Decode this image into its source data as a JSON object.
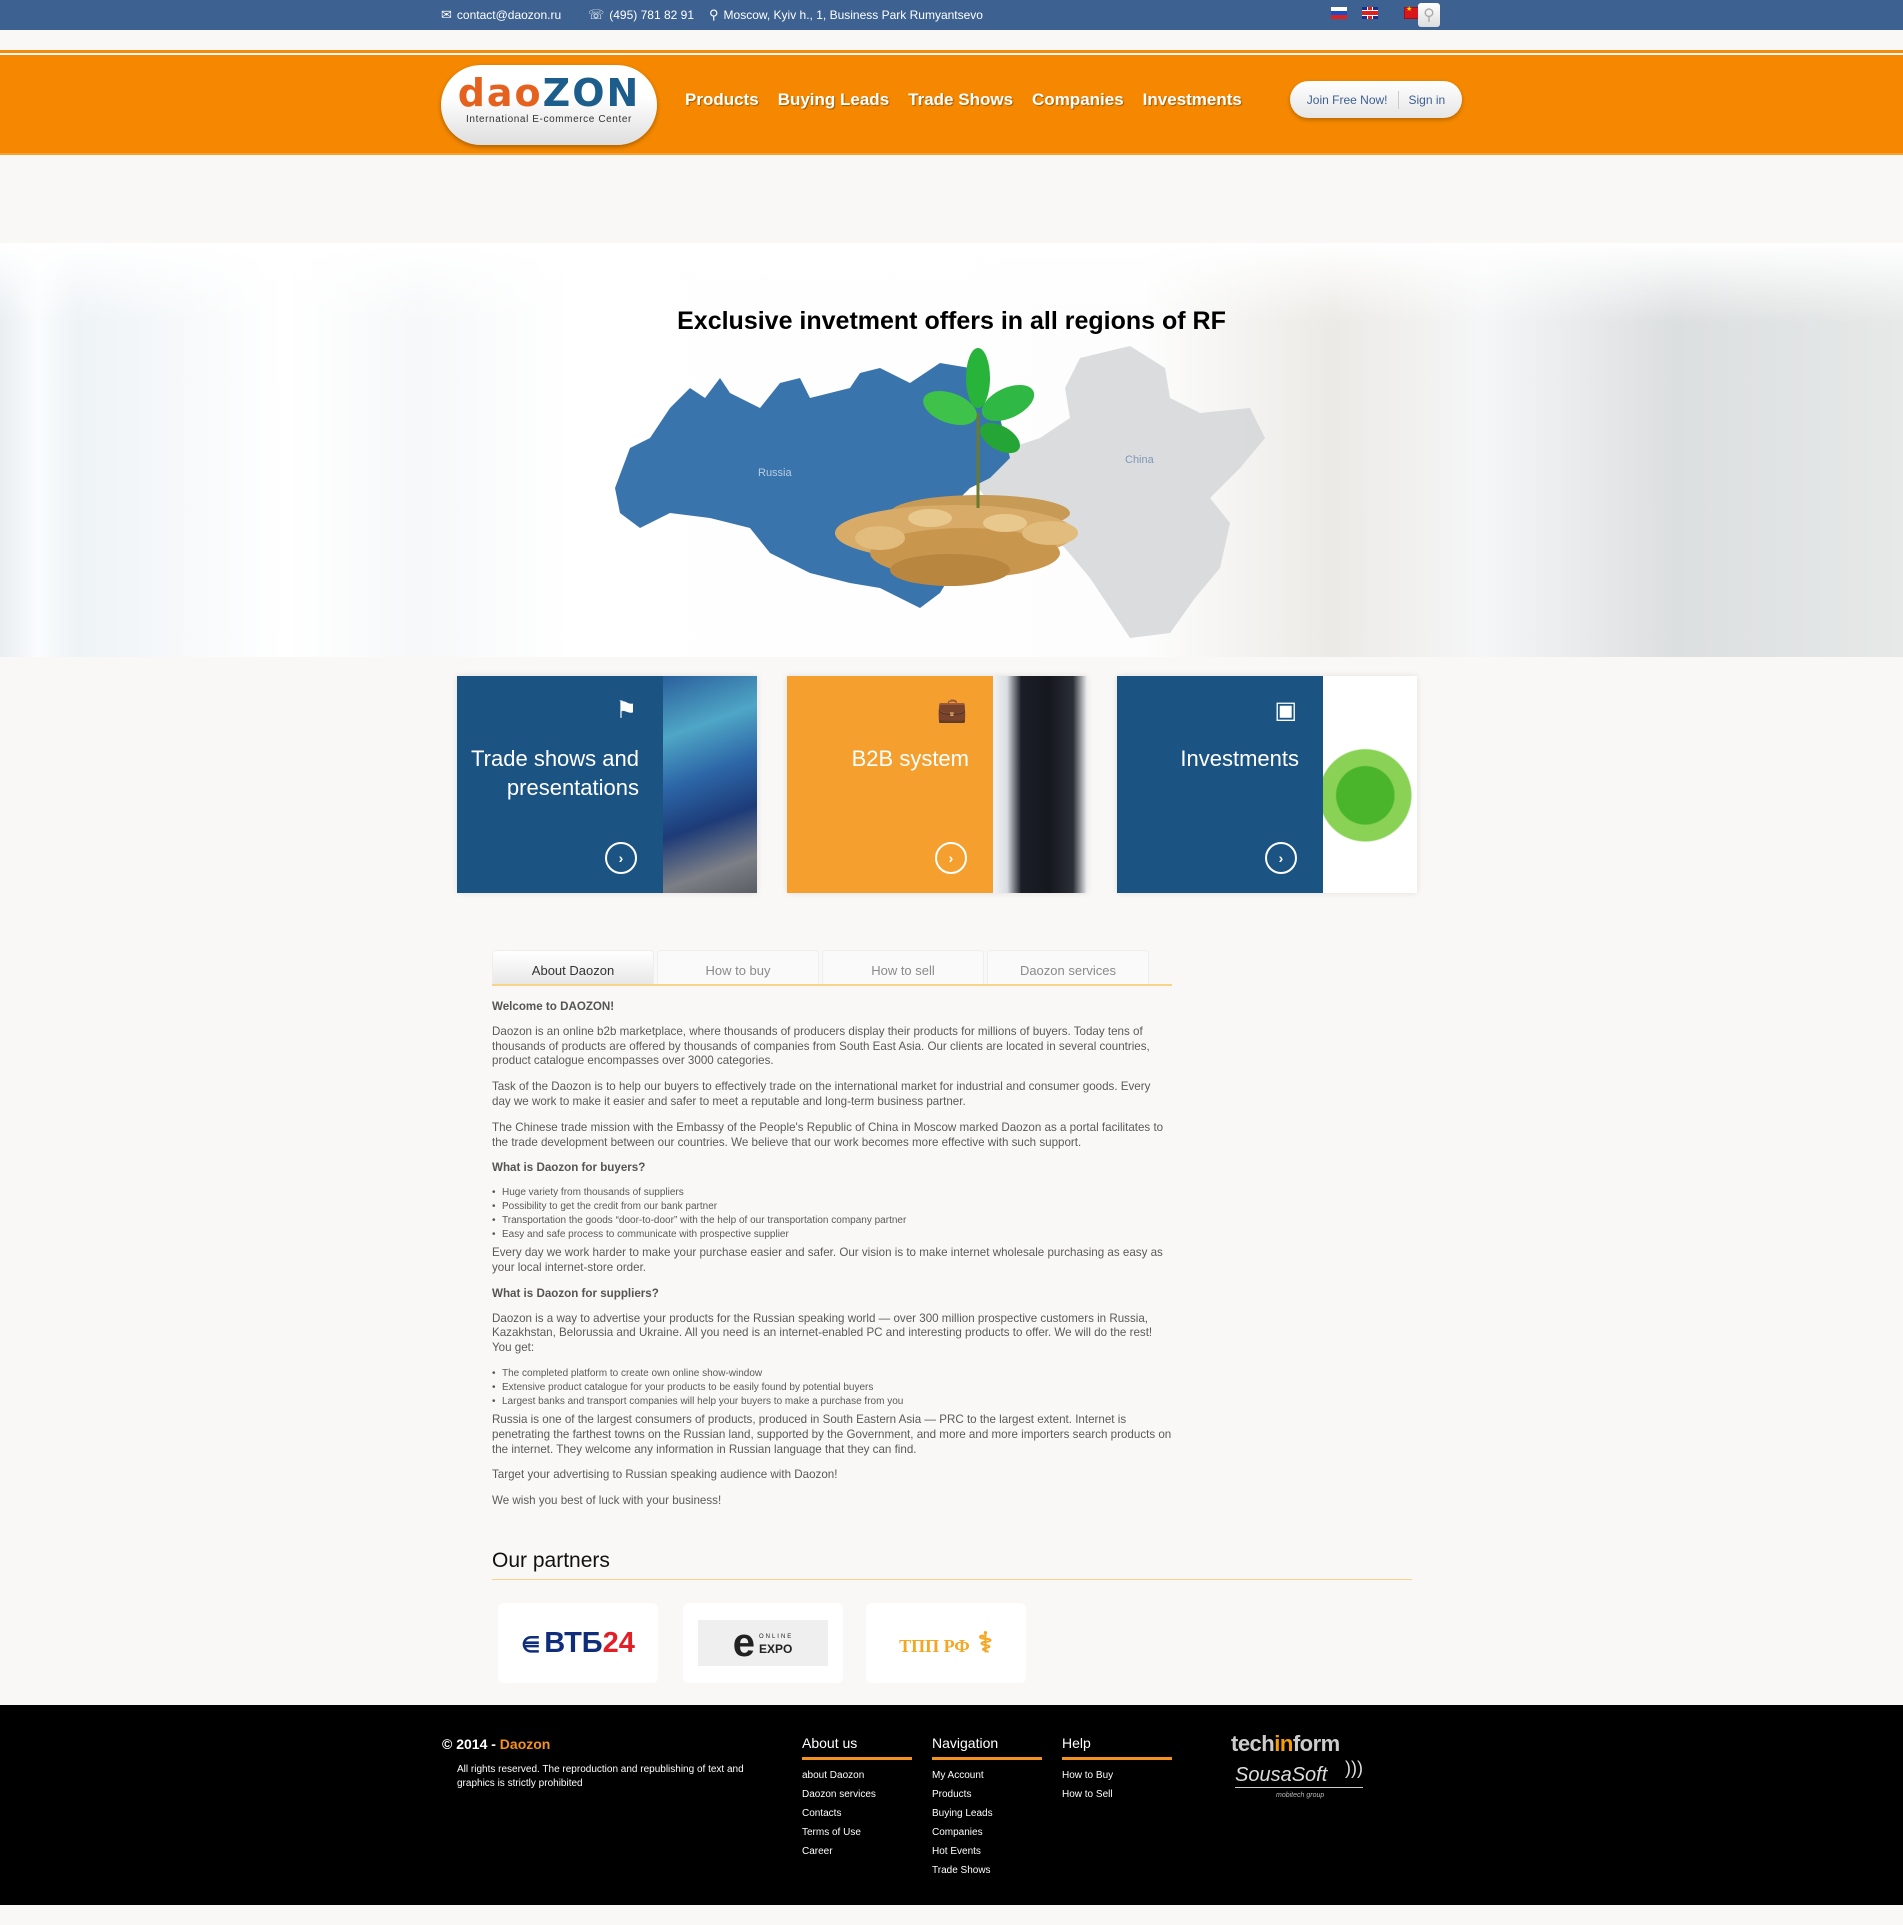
{
  "topbar": {
    "email": "contact@daozon.ru",
    "phone": "(495) 781 82 91",
    "address": "Moscow, Kyiv h., 1, Business Park Rumyantsevo",
    "languages": [
      "Russian",
      "English",
      "Chinese"
    ],
    "icons": {
      "email": "envelope-icon",
      "phone": "phone-icon",
      "address": "map-marker-icon",
      "search": "search-icon"
    }
  },
  "header": {
    "logo": {
      "word_a": "dao",
      "word_b": "ZON",
      "tagline": "International E-commerce Center"
    },
    "nav": [
      "Products",
      "Buying Leads",
      "Trade Shows",
      "Companies",
      "Investments"
    ],
    "join_label": "Join Free Now!",
    "signin_label": "Sign in"
  },
  "hero": {
    "title": "Exclusive invetment offers in all regions of RF",
    "map_labels": {
      "russia": "Russia",
      "china": "China"
    },
    "colors": {
      "russia": "#3a74ad",
      "china": "#d6d8da"
    }
  },
  "cards": [
    {
      "title": "Trade shows and presentations",
      "icon": "flag-icon",
      "color": "#1b5483"
    },
    {
      "title": "B2B system",
      "icon": "briefcase-icon",
      "color": "#f5a02e"
    },
    {
      "title": "Investments",
      "icon": "presentation-board-icon",
      "color": "#1b5483"
    }
  ],
  "tabs": [
    {
      "label": "About Daozon",
      "active": true
    },
    {
      "label": "How to buy",
      "active": false
    },
    {
      "label": "How to sell",
      "active": false
    },
    {
      "label": "Daozon services",
      "active": false
    }
  ],
  "about": {
    "welcome": "Welcome to DAOZON!",
    "p1": "Daozon is an online b2b marketplace, where thousands of producers display their products for millions of buyers. Today tens of thousands of products are offered by thousands of companies from South East Asia. Our clients are located in several countries, product catalogue encompasses over 3000 categories.",
    "p2": "Task of the Daozon is to help our buyers to effectively trade on the international market for industrial and consumer goods. Every day we work to make it easier and safer to meet a reputable and long-term business partner.",
    "p3": "The Chinese trade mission with the Embassy of the People's Republic of China in Moscow marked Daozon as a portal facilitates to the trade development between our countries. We believe that our work becomes more effective with such support.",
    "buyers_heading": "What is Daozon for buyers?",
    "buyers_list": [
      "Huge variety from thousands of suppliers",
      "Possibility to get the credit from our bank partner",
      "Transportation the goods “door-to-door” with the help of our transportation company partner",
      "Easy and safe process to communicate with prospective supplier"
    ],
    "p4": "Every day we work harder to make your purchase easier and safer. Our vision is to make internet wholesale purchasing as easy as your local internet-store order.",
    "suppliers_heading": "What is Daozon for suppliers?",
    "p5": "Daozon is a way to advertise your products for the Russian speaking world — over 300 million prospective customers in Russia, Kazakhstan, Belorussia and Ukraine. All you need is an internet-enabled PC and interesting products to offer. We will do the rest! You get:",
    "suppliers_list": [
      "The completed platform to create own online show-window",
      "Extensive product catalogue for your products to be easily found by potential buyers",
      "Largest banks and transport companies will help your buyers to make a purchase from you"
    ],
    "p6": "Russia is one of the largest consumers of products, produced in South Eastern Asia — PRC to the largest extent. Internet is penetrating the farthest towns on the Russian land, supported by the Government, and more and more importers search products on the internet. They welcome any information in Russian language that they can find.",
    "p7": "Target your advertising to Russian speaking audience with Daozon!",
    "p8": "We wish you best of luck with your business!"
  },
  "partners": {
    "title": "Our partners",
    "items": [
      {
        "name_a": "ВТБ",
        "name_b": "24"
      },
      {
        "name_top": "ONLINE",
        "name": "EXPO",
        "glyph": "e"
      },
      {
        "name": "ТПП РФ",
        "glyph": "⚕"
      }
    ]
  },
  "footer": {
    "copyright_prefix": "© 2014 - ",
    "brand": "Daozon",
    "rights": "All rights reserved. The reproduction and republishing of text and graphics is strictly prohibited",
    "columns": [
      {
        "title": "About us",
        "links": [
          "about Daozon",
          "Daozon services",
          "Contacts",
          "Terms of Use",
          "Career"
        ]
      },
      {
        "title": "Navigation",
        "links": [
          "My Account",
          "Products",
          "Buying Leads",
          "Companies",
          "Hot Events",
          "Trade Shows"
        ]
      },
      {
        "title": "Help",
        "links": [
          "How to Buy",
          "How to Sell"
        ]
      }
    ],
    "credits": {
      "tech_a": "tech",
      "tech_b": "in",
      "tech_c": "form",
      "sousa": "SousaSoft",
      "sousa_sub": "mobitech group"
    }
  }
}
